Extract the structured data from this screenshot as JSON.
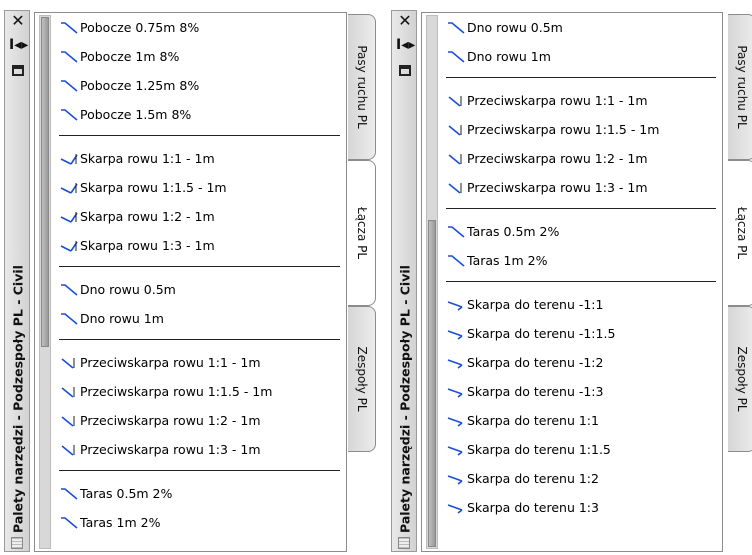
{
  "palette_title": "Palety narzędzi - Podzespoły PL - Civil",
  "tabs": [
    "Pasy ruchu PL",
    "Łącza PL",
    "Zespoły PL"
  ],
  "left_palette": {
    "active_tab": "Łącza PL",
    "items": [
      {
        "label": "Pobocze 0.75m 8%",
        "icon": "shoulder-icon"
      },
      {
        "label": "Pobocze 1m 8%",
        "icon": "shoulder-icon"
      },
      {
        "label": "Pobocze 1.25m 8%",
        "icon": "shoulder-icon"
      },
      {
        "label": "Pobocze 1.5m 8%",
        "icon": "shoulder-icon"
      },
      {
        "sep": true
      },
      {
        "label": "Skarpa rowu 1:1 - 1m",
        "icon": "ditch-slope-icon"
      },
      {
        "label": "Skarpa rowu 1:1.5 - 1m",
        "icon": "ditch-slope-icon"
      },
      {
        "label": "Skarpa rowu 1:2 - 1m",
        "icon": "ditch-slope-icon"
      },
      {
        "label": "Skarpa rowu 1:3 - 1m",
        "icon": "ditch-slope-icon"
      },
      {
        "sep": true
      },
      {
        "label": "Dno rowu 0.5m",
        "icon": "ditch-bottom-icon"
      },
      {
        "label": "Dno rowu 1m",
        "icon": "ditch-bottom-icon"
      },
      {
        "sep": true
      },
      {
        "label": "Przeciwskarpa rowu 1:1 - 1m",
        "icon": "backslope-icon"
      },
      {
        "label": "Przeciwskarpa rowu 1:1.5 - 1m",
        "icon": "backslope-icon"
      },
      {
        "label": "Przeciwskarpa rowu 1:2 - 1m",
        "icon": "backslope-icon"
      },
      {
        "label": "Przeciwskarpa rowu 1:3 - 1m",
        "icon": "backslope-icon"
      },
      {
        "sep": true
      },
      {
        "label": "Taras 0.5m 2%",
        "icon": "terrace-icon"
      },
      {
        "label": "Taras 1m 2%",
        "icon": "terrace-icon"
      }
    ],
    "scroll_position": 0.0
  },
  "right_palette": {
    "active_tab": "Łącza PL",
    "items": [
      {
        "label": "Dno rowu 0.5m",
        "icon": "ditch-bottom-icon"
      },
      {
        "label": "Dno rowu 1m",
        "icon": "ditch-bottom-icon"
      },
      {
        "sep": true
      },
      {
        "label": "Przeciwskarpa rowu 1:1 - 1m",
        "icon": "backslope-icon"
      },
      {
        "label": "Przeciwskarpa rowu 1:1.5 - 1m",
        "icon": "backslope-icon"
      },
      {
        "label": "Przeciwskarpa rowu 1:2 - 1m",
        "icon": "backslope-icon"
      },
      {
        "label": "Przeciwskarpa rowu 1:3 - 1m",
        "icon": "backslope-icon"
      },
      {
        "sep": true
      },
      {
        "label": "Taras 0.5m 2%",
        "icon": "terrace-icon"
      },
      {
        "label": "Taras 1m 2%",
        "icon": "terrace-icon"
      },
      {
        "sep": true
      },
      {
        "label": "Skarpa do terenu -1:1",
        "icon": "daylight-icon"
      },
      {
        "label": "Skarpa do terenu -1:1.5",
        "icon": "daylight-icon"
      },
      {
        "label": "Skarpa do terenu -1:2",
        "icon": "daylight-icon"
      },
      {
        "label": "Skarpa do terenu -1:3",
        "icon": "daylight-icon"
      },
      {
        "label": "Skarpa do terenu 1:1",
        "icon": "daylight-icon"
      },
      {
        "label": "Skarpa do terenu 1:1.5",
        "icon": "daylight-icon"
      },
      {
        "label": "Skarpa do terenu 1:2",
        "icon": "daylight-icon"
      },
      {
        "label": "Skarpa do terenu 1:3",
        "icon": "daylight-icon"
      }
    ],
    "scroll_position": 1.0
  },
  "colors": {
    "icon_blue": "#1a4fd6",
    "icon_dark": "#222222"
  }
}
